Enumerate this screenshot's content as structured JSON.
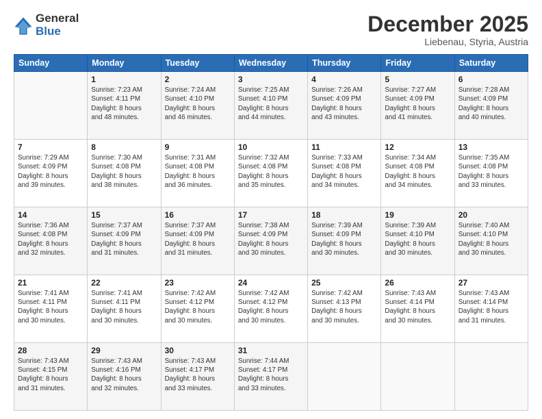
{
  "logo": {
    "general": "General",
    "blue": "Blue"
  },
  "header": {
    "month": "December 2025",
    "location": "Liebenau, Styria, Austria"
  },
  "days_of_week": [
    "Sunday",
    "Monday",
    "Tuesday",
    "Wednesday",
    "Thursday",
    "Friday",
    "Saturday"
  ],
  "weeks": [
    [
      {
        "day": "",
        "info": ""
      },
      {
        "day": "1",
        "info": "Sunrise: 7:23 AM\nSunset: 4:11 PM\nDaylight: 8 hours\nand 48 minutes."
      },
      {
        "day": "2",
        "info": "Sunrise: 7:24 AM\nSunset: 4:10 PM\nDaylight: 8 hours\nand 46 minutes."
      },
      {
        "day": "3",
        "info": "Sunrise: 7:25 AM\nSunset: 4:10 PM\nDaylight: 8 hours\nand 44 minutes."
      },
      {
        "day": "4",
        "info": "Sunrise: 7:26 AM\nSunset: 4:09 PM\nDaylight: 8 hours\nand 43 minutes."
      },
      {
        "day": "5",
        "info": "Sunrise: 7:27 AM\nSunset: 4:09 PM\nDaylight: 8 hours\nand 41 minutes."
      },
      {
        "day": "6",
        "info": "Sunrise: 7:28 AM\nSunset: 4:09 PM\nDaylight: 8 hours\nand 40 minutes."
      }
    ],
    [
      {
        "day": "7",
        "info": "Sunrise: 7:29 AM\nSunset: 4:09 PM\nDaylight: 8 hours\nand 39 minutes."
      },
      {
        "day": "8",
        "info": "Sunrise: 7:30 AM\nSunset: 4:08 PM\nDaylight: 8 hours\nand 38 minutes."
      },
      {
        "day": "9",
        "info": "Sunrise: 7:31 AM\nSunset: 4:08 PM\nDaylight: 8 hours\nand 36 minutes."
      },
      {
        "day": "10",
        "info": "Sunrise: 7:32 AM\nSunset: 4:08 PM\nDaylight: 8 hours\nand 35 minutes."
      },
      {
        "day": "11",
        "info": "Sunrise: 7:33 AM\nSunset: 4:08 PM\nDaylight: 8 hours\nand 34 minutes."
      },
      {
        "day": "12",
        "info": "Sunrise: 7:34 AM\nSunset: 4:08 PM\nDaylight: 8 hours\nand 34 minutes."
      },
      {
        "day": "13",
        "info": "Sunrise: 7:35 AM\nSunset: 4:08 PM\nDaylight: 8 hours\nand 33 minutes."
      }
    ],
    [
      {
        "day": "14",
        "info": "Sunrise: 7:36 AM\nSunset: 4:08 PM\nDaylight: 8 hours\nand 32 minutes."
      },
      {
        "day": "15",
        "info": "Sunrise: 7:37 AM\nSunset: 4:09 PM\nDaylight: 8 hours\nand 31 minutes."
      },
      {
        "day": "16",
        "info": "Sunrise: 7:37 AM\nSunset: 4:09 PM\nDaylight: 8 hours\nand 31 minutes."
      },
      {
        "day": "17",
        "info": "Sunrise: 7:38 AM\nSunset: 4:09 PM\nDaylight: 8 hours\nand 30 minutes."
      },
      {
        "day": "18",
        "info": "Sunrise: 7:39 AM\nSunset: 4:09 PM\nDaylight: 8 hours\nand 30 minutes."
      },
      {
        "day": "19",
        "info": "Sunrise: 7:39 AM\nSunset: 4:10 PM\nDaylight: 8 hours\nand 30 minutes."
      },
      {
        "day": "20",
        "info": "Sunrise: 7:40 AM\nSunset: 4:10 PM\nDaylight: 8 hours\nand 30 minutes."
      }
    ],
    [
      {
        "day": "21",
        "info": "Sunrise: 7:41 AM\nSunset: 4:11 PM\nDaylight: 8 hours\nand 30 minutes."
      },
      {
        "day": "22",
        "info": "Sunrise: 7:41 AM\nSunset: 4:11 PM\nDaylight: 8 hours\nand 30 minutes."
      },
      {
        "day": "23",
        "info": "Sunrise: 7:42 AM\nSunset: 4:12 PM\nDaylight: 8 hours\nand 30 minutes."
      },
      {
        "day": "24",
        "info": "Sunrise: 7:42 AM\nSunset: 4:12 PM\nDaylight: 8 hours\nand 30 minutes."
      },
      {
        "day": "25",
        "info": "Sunrise: 7:42 AM\nSunset: 4:13 PM\nDaylight: 8 hours\nand 30 minutes."
      },
      {
        "day": "26",
        "info": "Sunrise: 7:43 AM\nSunset: 4:14 PM\nDaylight: 8 hours\nand 30 minutes."
      },
      {
        "day": "27",
        "info": "Sunrise: 7:43 AM\nSunset: 4:14 PM\nDaylight: 8 hours\nand 31 minutes."
      }
    ],
    [
      {
        "day": "28",
        "info": "Sunrise: 7:43 AM\nSunset: 4:15 PM\nDaylight: 8 hours\nand 31 minutes."
      },
      {
        "day": "29",
        "info": "Sunrise: 7:43 AM\nSunset: 4:16 PM\nDaylight: 8 hours\nand 32 minutes."
      },
      {
        "day": "30",
        "info": "Sunrise: 7:43 AM\nSunset: 4:17 PM\nDaylight: 8 hours\nand 33 minutes."
      },
      {
        "day": "31",
        "info": "Sunrise: 7:44 AM\nSunset: 4:17 PM\nDaylight: 8 hours\nand 33 minutes."
      },
      {
        "day": "",
        "info": ""
      },
      {
        "day": "",
        "info": ""
      },
      {
        "day": "",
        "info": ""
      }
    ]
  ]
}
